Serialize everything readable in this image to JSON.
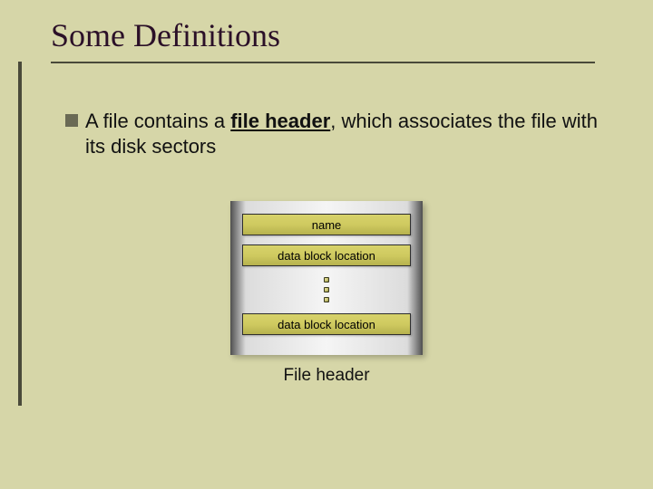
{
  "title": "Some Definitions",
  "bullet": {
    "prefix": "A file contains a ",
    "term": "file header",
    "suffix": ", which associates the file with its disk sectors"
  },
  "figure": {
    "field_name": "name",
    "field_block_a": "data block location",
    "field_block_b": "data block location",
    "caption": "File header"
  }
}
